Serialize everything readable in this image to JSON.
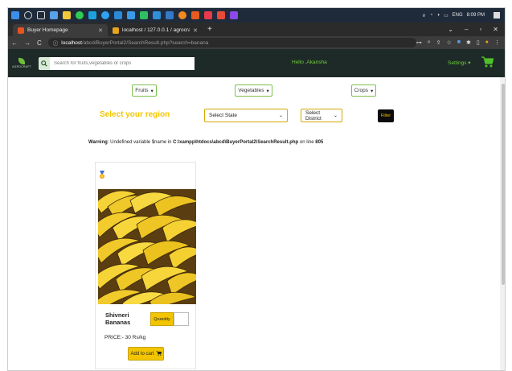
{
  "browser": {
    "tabs": [
      {
        "label": "Buyer Homepage",
        "favicon_color": "#e8531f",
        "active": true
      },
      {
        "label": "localhost / 127.0.0.1 / agrocraft / ...",
        "favicon_color": "#e8a31f",
        "active": false
      }
    ],
    "url_host": "localhost",
    "url_path": "/abcd/BuyerPortal2/SearchResult.php?search=banana"
  },
  "taskbar": {
    "lang": "ENG",
    "time": "8:09 PM"
  },
  "header": {
    "logo_text": "AGROCRAFT",
    "search_placeholder": "Search for fruits,vegetables or crops",
    "greeting": "Hello ,Akansha",
    "settings_label": "Settings"
  },
  "filters": {
    "categories": [
      "Fruits",
      "Vegetables",
      "Crops"
    ],
    "region_title": "Select your region",
    "state_selected": "Select State",
    "district_selected": "Select District",
    "filter_label": "Filter"
  },
  "warning": {
    "label": "Warning",
    "message": ": Undefined variable $name in ",
    "file": "C:\\xampp\\htdocs\\abcd\\BuyerPortal2\\SearchResult.php",
    "line_text": " on line ",
    "line": "805"
  },
  "product": {
    "name": "Shivneri Bananas",
    "quantity_label": "Quantity",
    "price": "PRICE:- 30 Rs/kg",
    "add_label": "Add to cart"
  },
  "colors": {
    "accent_yellow": "#f2c500",
    "header_bg": "#1e2a27",
    "accent_green": "#6fcf3a"
  }
}
